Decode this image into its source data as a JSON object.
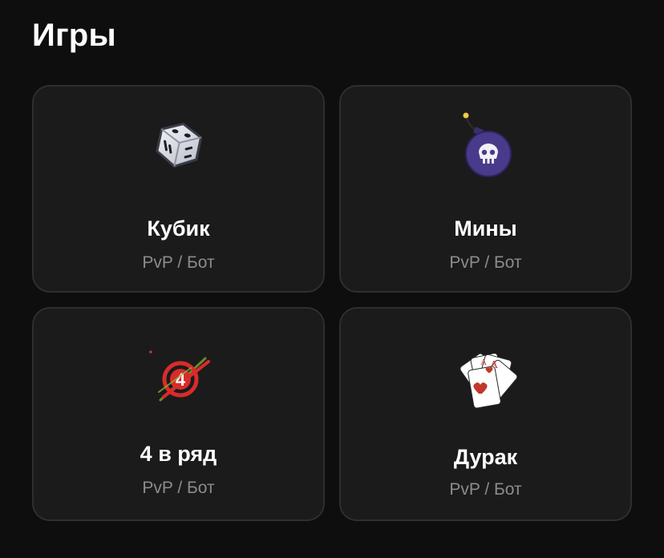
{
  "header": {
    "title": "Игры"
  },
  "games": [
    {
      "name": "Кубик",
      "mode": "PvP / Бот",
      "icon": "dice-icon"
    },
    {
      "name": "Мины",
      "mode": "PvP / Бот",
      "icon": "bomb-icon"
    },
    {
      "name": "4 в ряд",
      "mode": "PvP / Бот",
      "icon": "four-in-a-row-icon"
    },
    {
      "name": "Дурак",
      "mode": "PvP / Бот",
      "icon": "playing-cards-icon"
    }
  ],
  "colors": {
    "background": "#0e0e0f",
    "card": "#1b1b1c",
    "card_border": "#2e2e30",
    "subtitle": "#8c8c8f"
  }
}
